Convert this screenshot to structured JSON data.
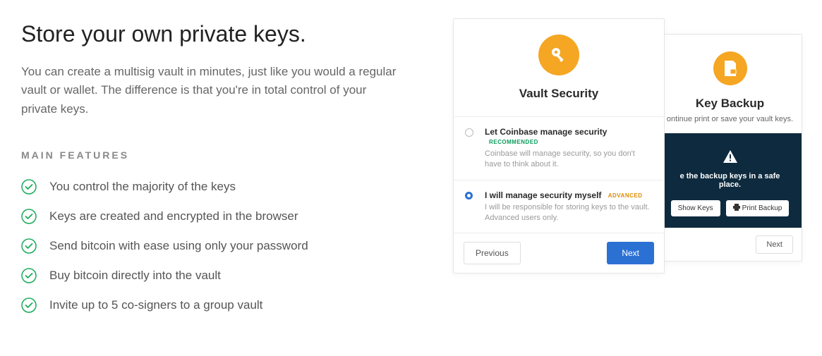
{
  "heading": "Store your own private keys.",
  "description": "You can create a multisig vault in minutes, just like you would a regular vault or wallet. The difference is that you're in total control of your private keys.",
  "section_label": "MAIN FEATURES",
  "features": [
    "You control the majority of the keys",
    "Keys are created and encrypted in the browser",
    "Send bitcoin with ease using only your password",
    "Buy bitcoin directly into the vault",
    "Invite up to 5 co-signers to a group vault"
  ],
  "security_card": {
    "title": "Vault Security",
    "options": [
      {
        "title": "Let Coinbase manage security",
        "tag": "RECOMMENDED",
        "description": "Coinbase will manage security, so you don't have to think about it."
      },
      {
        "title": "I will manage security myself",
        "tag": "ADVANCED",
        "description": "I will be responsible for storing keys to the vault. Advanced users only."
      }
    ],
    "previous": "Previous",
    "next": "Next"
  },
  "backup_card": {
    "title": "Key Backup",
    "subtitle": "ontinue print or save your vault keys.",
    "warning": "e the backup keys in a safe place.",
    "show_keys": "Show Keys",
    "print_backup": "Print Backup",
    "next": "Next"
  }
}
